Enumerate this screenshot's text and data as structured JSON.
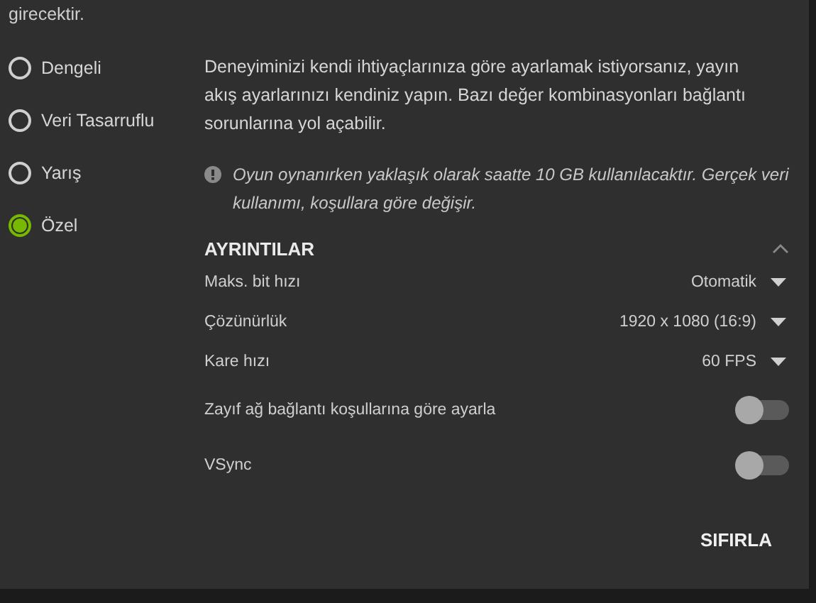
{
  "intro_tail": "girecektir.",
  "presets": [
    {
      "label": "Dengeli",
      "selected": false
    },
    {
      "label": "Veri Tasarruflu",
      "selected": false
    },
    {
      "label": "Yarış",
      "selected": false
    },
    {
      "label": "Özel",
      "selected": true
    }
  ],
  "description": "Deneyiminizi kendi ihtiyaçlarınıza göre ayarlamak istiyorsanız, yayın akış ayarlarınızı kendiniz yapın. Bazı değer kombinasyonları bağlantı sorunlarına yol açabilir.",
  "notice": "Oyun oynanırken yaklaşık olarak saatte 10 GB kullanılacaktır. Gerçek veri kullanımı, koşullara göre değişir.",
  "details": {
    "title": "AYRINTILAR",
    "expanded": true,
    "settings": [
      {
        "kind": "dropdown",
        "label": "Maks. bit hızı",
        "value": "Otomatik"
      },
      {
        "kind": "dropdown",
        "label": "Çözünürlük",
        "value": "1920 x 1080 (16:9)"
      },
      {
        "kind": "dropdown",
        "label": "Kare hızı",
        "value": "60 FPS"
      },
      {
        "kind": "toggle",
        "label": "Zayıf ağ bağlantı koşullarına göre ayarla",
        "on": false
      },
      {
        "kind": "toggle",
        "label": "VSync",
        "on": false
      }
    ]
  },
  "reset_button": "SIFIRLA"
}
